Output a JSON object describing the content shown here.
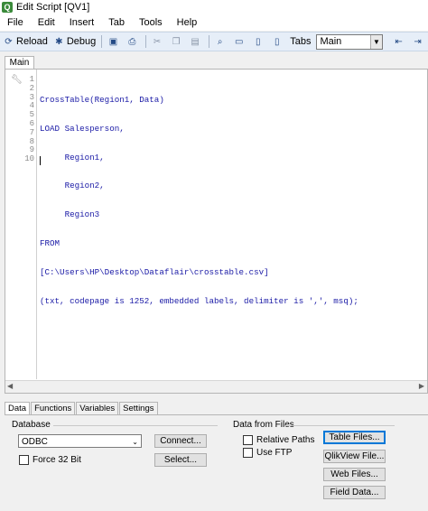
{
  "window": {
    "title": "Edit Script [QV1]"
  },
  "menu": [
    "File",
    "Edit",
    "Insert",
    "Tab",
    "Tools",
    "Help"
  ],
  "toolbar": {
    "reload_label": "Reload",
    "debug_label": "Debug",
    "tabs_label": "Tabs",
    "tab_select_value": "Main"
  },
  "editor": {
    "tab_label": "Main",
    "lines": [
      "CrossTable(Region1, Data)",
      "LOAD Salesperson,",
      "     Region1,",
      "     Region2,",
      "     Region3",
      "FROM",
      "[C:\\Users\\HP\\Desktop\\Dataflair\\crosstable.csv]",
      "(txt, codepage is 1252, embedded labels, delimiter is ',', msq);",
      "",
      ""
    ],
    "line_numbers": [
      "1",
      "2",
      "3",
      "4",
      "5",
      "6",
      "7",
      "8",
      "9",
      "10"
    ]
  },
  "bottom_tabs": [
    "Data",
    "Functions",
    "Variables",
    "Settings"
  ],
  "database": {
    "label": "Database",
    "selected": "ODBC",
    "connect_label": "Connect...",
    "select_label": "Select...",
    "force32_label": "Force 32 Bit"
  },
  "files": {
    "label": "Data from Files",
    "relative_paths_label": "Relative Paths",
    "use_ftp_label": "Use FTP",
    "table_files_label": "Table Files...",
    "qlikview_file_label": "QlikView File...",
    "web_files_label": "Web Files...",
    "field_data_label": "Field Data..."
  }
}
